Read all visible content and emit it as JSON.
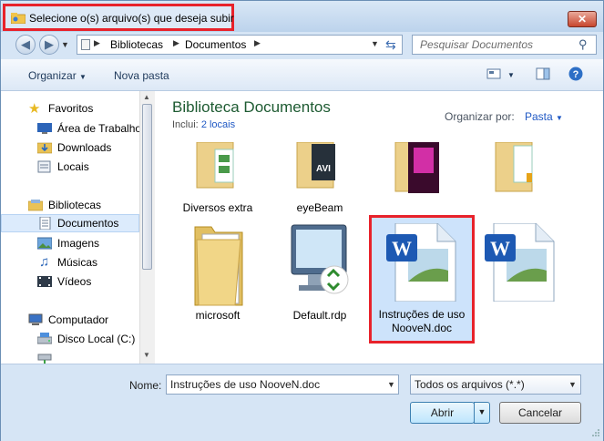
{
  "window": {
    "title": "Selecione o(s) arquivo(s) que deseja subir",
    "close_label": "✕"
  },
  "address": {
    "crumbs": [
      "Bibliotecas",
      "Documentos"
    ],
    "search_placeholder": "Pesquisar Documentos"
  },
  "toolbar": {
    "organize": "Organizar",
    "new_folder": "Nova pasta"
  },
  "nav": {
    "favorites": "Favoritos",
    "desktop": "Área de Trabalho",
    "downloads": "Downloads",
    "places": "Locais",
    "libraries": "Bibliotecas",
    "documents": "Documentos",
    "images": "Imagens",
    "music": "Músicas",
    "videos": "Vídeos",
    "computer": "Computador",
    "local_disk": "Disco Local (C:)"
  },
  "library": {
    "title": "Biblioteca Documentos",
    "includes_label": "Inclui:",
    "includes_link": "2 locais",
    "arrange_label": "Organizar por:",
    "arrange_value": "Pasta"
  },
  "files": [
    {
      "name": "Diversos extra"
    },
    {
      "name": "eyeBeam"
    },
    {
      "name": "microsoft"
    },
    {
      "name": "Default.rdp"
    },
    {
      "name": "Instruções de uso NooveN.doc"
    }
  ],
  "footer": {
    "name_label": "Nome:",
    "name_value": "Instruções de uso NooveN.doc",
    "type_value": "Todos os arquivos (*.*)",
    "open_label": "Abrir",
    "cancel_label": "Cancelar"
  },
  "colors": {
    "highlight": "#e8222b",
    "library_title": "#1e5b32",
    "link": "#1f58c4"
  }
}
